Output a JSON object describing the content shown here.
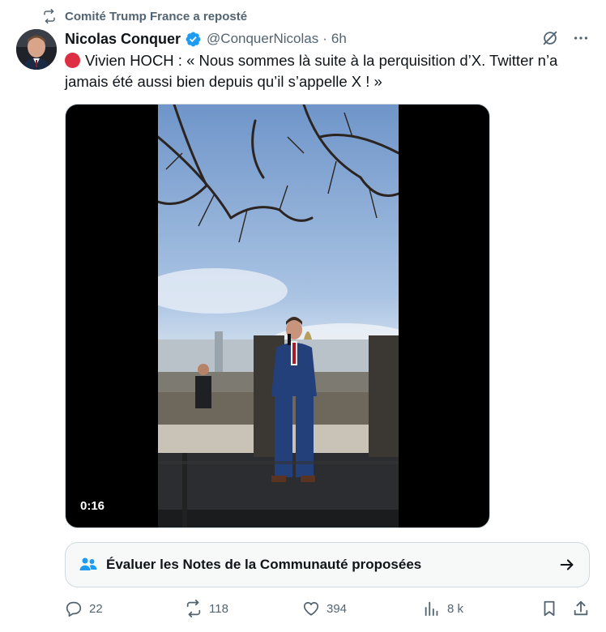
{
  "repost_banner": {
    "text": "Comité Trump France a reposté",
    "icon": "repost-icon"
  },
  "author": {
    "name": "Nicolas Conquer",
    "handle": "@ConquerNicolas",
    "separator": "·",
    "time": "6h",
    "verified": true,
    "avatar_icon": "avatar"
  },
  "header_actions": [
    "grok-icon",
    "more-icon"
  ],
  "tweet": {
    "emoji": "red-circle",
    "text": "Vivien HOCH : « Nous sommes là suite à la perquisition d’X. Twitter n’a jamais été aussi bien depuis qu’il s’appelle X ! »"
  },
  "media": {
    "type": "video",
    "duration": "0:16"
  },
  "community_notes": {
    "label": "Évaluer les Notes de la Communauté proposées",
    "icon": "people-icon",
    "arrow_icon": "arrow-right-icon"
  },
  "actions": {
    "reply": {
      "icon": "reply-icon",
      "count": "22"
    },
    "repost": {
      "icon": "repost-icon",
      "count": "118"
    },
    "like": {
      "icon": "heart-icon",
      "count": "394"
    },
    "views": {
      "icon": "views-icon",
      "count": "8 k"
    },
    "bookmark": {
      "icon": "bookmark-icon"
    },
    "share": {
      "icon": "share-icon"
    }
  },
  "colors": {
    "text": "#0f1419",
    "secondary": "#536471",
    "verified": "#1d9bf0",
    "border": "#cfd9de",
    "red_dot": "#dd2e44"
  }
}
